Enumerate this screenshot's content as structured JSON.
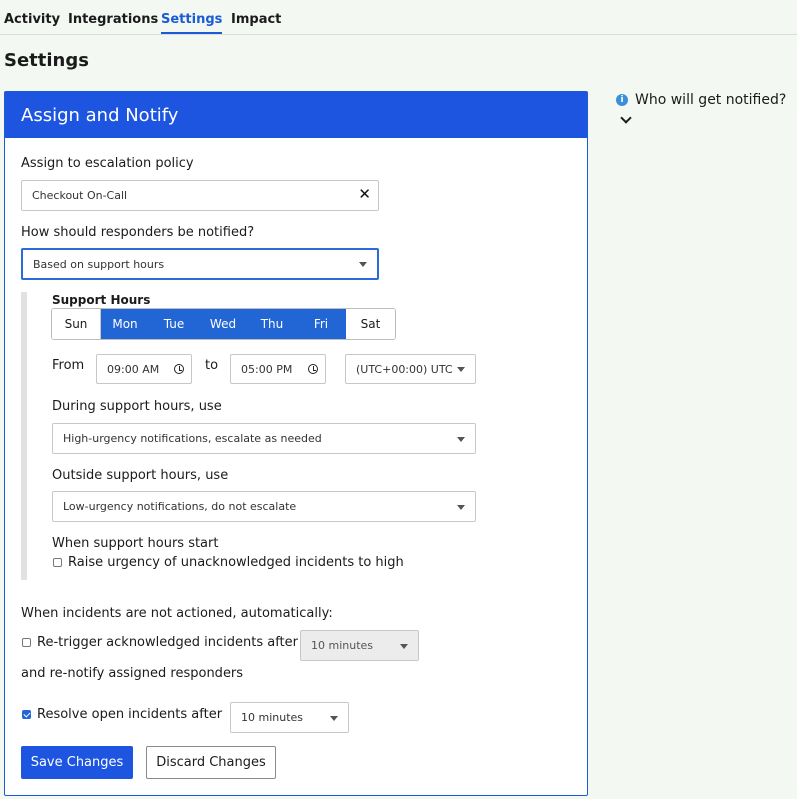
{
  "tabs": [
    {
      "label": "Activity"
    },
    {
      "label": "Integrations"
    },
    {
      "label": "Settings"
    },
    {
      "label": "Impact"
    }
  ],
  "active_tab": "Settings",
  "page_title": "Settings",
  "panel": {
    "title": "Assign and Notify",
    "escalation": {
      "label": "Assign to escalation policy",
      "value": "Checkout On-Call"
    },
    "notify": {
      "label": "How should responders be notified?",
      "value": "Based on support hours"
    },
    "support_hours": {
      "title": "Support Hours",
      "days": [
        {
          "label": "Sun",
          "selected": false
        },
        {
          "label": "Mon",
          "selected": true
        },
        {
          "label": "Tue",
          "selected": true
        },
        {
          "label": "Wed",
          "selected": true
        },
        {
          "label": "Thu",
          "selected": true
        },
        {
          "label": "Fri",
          "selected": true
        },
        {
          "label": "Sat",
          "selected": false
        }
      ],
      "from_label": "From",
      "from_value": "09:00 AM",
      "to_label": "to",
      "to_value": "05:00 PM",
      "timezone": "(UTC+00:00) UTC",
      "during_label": "During support hours, use",
      "during_value": "High-urgency notifications, escalate as needed",
      "outside_label": "Outside support hours, use",
      "outside_value": "Low-urgency notifications, do not escalate",
      "start_label": "When support hours start",
      "raise_label": "Raise urgency of unacknowledged incidents to high",
      "raise_checked": false
    },
    "auto": {
      "label": "When incidents are not actioned, automatically:",
      "retrigger_label": "Re-trigger acknowledged incidents after",
      "retrigger_checked": false,
      "retrigger_value": "10 minutes",
      "renotify_label": "and re-notify assigned responders",
      "resolve_label": "Resolve open incidents after",
      "resolve_checked": true,
      "resolve_value": "10 minutes"
    },
    "save_label": "Save Changes",
    "discard_label": "Discard Changes"
  },
  "side": {
    "info_icon_glyph": "i",
    "who_label": "Who will get notified?"
  },
  "colors": {
    "accent": "#1d55e0",
    "selected_day": "#2266d6",
    "background": "#f3f8f3",
    "info_icon": "#3b8fd9"
  }
}
